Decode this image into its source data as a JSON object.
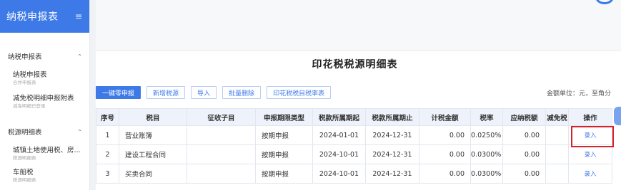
{
  "sidebar": {
    "title": "纳税申报表",
    "groups": [
      {
        "label": "纳税申报表",
        "items": [
          {
            "name": "纳税申报表",
            "sub": "合并申报表"
          },
          {
            "name": "减免税明细申报附表",
            "sub": "减免明细已登录"
          }
        ]
      },
      {
        "label": "税源明细表",
        "items": [
          {
            "name": "城镇土地使用税、房...",
            "sub": "税源明细表"
          },
          {
            "name": "车船税",
            "sub": "税源明细表"
          }
        ]
      }
    ]
  },
  "main": {
    "title": "印花税税源明细表",
    "toolbar": [
      "一键零申报",
      "新增税源",
      "导入",
      "批量删除",
      "印花税税目税率表"
    ],
    "unit_text": "金额单位：元，至角分",
    "columns": [
      "序号",
      "税目",
      "征收子目",
      "申报期限类型",
      "税款所属期起",
      "税款所属期止",
      "计税金额",
      "税率",
      "应纳税额",
      "减免税",
      "操作"
    ],
    "rows": [
      {
        "seq": "1",
        "item": "营业账簿",
        "sub": "",
        "period_type": "按期申报",
        "start": "2024-01-01",
        "end": "2024-12-31",
        "amount": "0.00",
        "rate": "0.0250%",
        "tax": "0.00",
        "relief": "",
        "action": "录入"
      },
      {
        "seq": "2",
        "item": "建设工程合同",
        "sub": "",
        "period_type": "按期申报",
        "start": "2024-10-01",
        "end": "2024-12-31",
        "amount": "0.00",
        "rate": "0.0300%",
        "tax": "0.00",
        "relief": "",
        "action": "录入"
      },
      {
        "seq": "3",
        "item": "买卖合同",
        "sub": "",
        "period_type": "按期申报",
        "start": "2024-10-01",
        "end": "2024-12-31",
        "amount": "0.00",
        "rate": "0.0300%",
        "tax": "0.00",
        "relief": "",
        "action": "录入"
      }
    ]
  },
  "colors": {
    "accent": "#3d7ae8",
    "highlight": "#d8202a"
  }
}
